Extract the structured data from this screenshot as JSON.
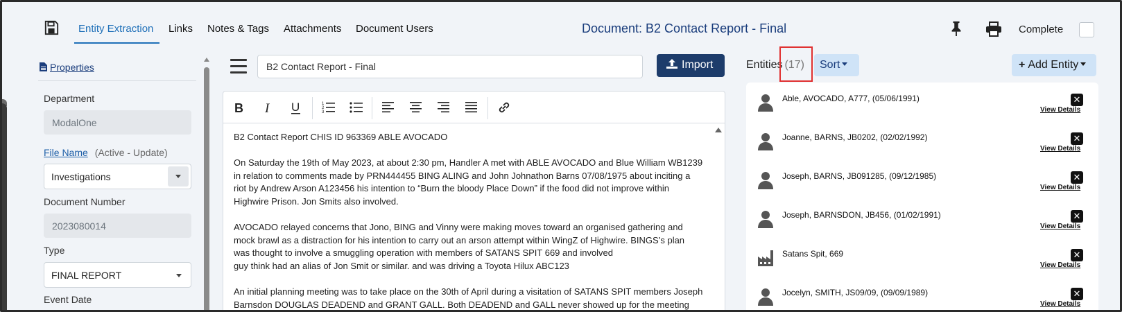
{
  "toolbar": {
    "tabs": [
      {
        "label": "Entity Extraction",
        "active": true
      },
      {
        "label": "Links"
      },
      {
        "label": "Notes & Tags"
      },
      {
        "label": "Attachments"
      },
      {
        "label": "Document Users"
      }
    ],
    "document_title": "Document: B2 Contact Report - Final",
    "complete_label": "Complete",
    "complete_checked": false
  },
  "sidebar": {
    "properties_link": "Properties",
    "department_label": "Department",
    "department_value": "ModalOne",
    "file_name_label": "File Name",
    "file_name_state": "(Active - Update)",
    "file_name_value": "Investigations",
    "document_number_label": "Document Number",
    "document_number_value": "2023080014",
    "type_label": "Type",
    "type_value": "FINAL REPORT",
    "event_date_label": "Event Date"
  },
  "editor": {
    "title_value": "B2 Contact Report - Final",
    "import_label": "Import",
    "toolbar_buttons": [
      "bold",
      "italic",
      "underline",
      "ordered-list",
      "unordered-list",
      "align-left",
      "align-center",
      "align-right",
      "align-justify",
      "link"
    ],
    "heading": "B2 Contact Report CHIS ID 963369 ABLE AVOCADO",
    "para1": [
      "On Saturday the 19th of May 2023, at about 2:30 pm, Handler A met with ABLE AVOCADO and Blue William WB1239",
      "in relation to comments made by PRN444455 BING ALING and John Johnathon Barns 07/08/1975 about inciting a",
      "riot by Andrew Arson A123456 his intention to “Burn the bloody Place Down” if the food did not improve within",
      "Highwire Prison. Jon Smits also involved."
    ],
    "para2": [
      "AVOCADO relayed concerns that Jono, BING and Vinny were making moves toward an organised gathering and",
      "mock brawl as a distraction for his intention to carry out an arson attempt within WingZ of Highwire. BINGS’s plan",
      "was thought to involve a smuggling operation with members of SATANS SPIT 669 and involved",
      "guy think had an alias of Jon Smit or similar. and was driving a Toyota Hilux ABC123"
    ],
    "para3": [
      "An initial planning meeting was to take place on the 30th of April during a visitation of SATANS SPIT members Joseph",
      "Barnsdon DOUGLAS DEADEND and GRANT GALL. Both DEADEND and GALL never showed up for the meeting"
    ]
  },
  "entities": {
    "title": "Entities",
    "count": "(17)",
    "sort_label": "Sort",
    "add_label": "Add Entity",
    "view_details_label": "View Details",
    "items": [
      {
        "name": "Able, AVOCADO, A777, (05/06/1991)",
        "icon": "person-icon"
      },
      {
        "name": "Joanne, BARNS, JB0202, (02/02/1992)",
        "icon": "person-icon"
      },
      {
        "name": "Joseph, BARNS, JB091285, (09/12/1985)",
        "icon": "person-icon"
      },
      {
        "name": "Joseph, BARNSDON, JB456, (01/02/1991)",
        "icon": "person-icon"
      },
      {
        "name": "Satans Spit, 669",
        "icon": "factory-icon"
      },
      {
        "name": "Jocelyn, SMITH, JS09/09, (09/09/1989)",
        "icon": "person-icon"
      }
    ]
  },
  "colors": {
    "accent": "#1e6fb8",
    "primary_button": "#1d3c6b",
    "light_button": "#cfe3f7",
    "highlight": "#e03030"
  }
}
